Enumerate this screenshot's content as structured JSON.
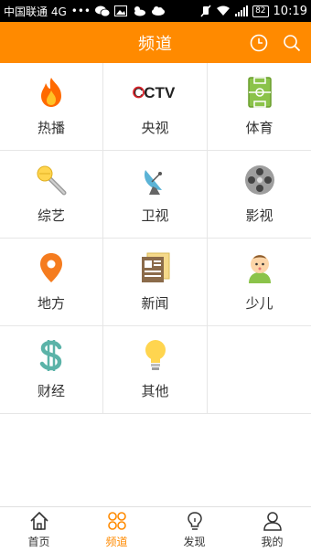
{
  "status_bar": {
    "carrier": "中国联通 4G",
    "dots": "•••",
    "battery": "82",
    "time": "10:19"
  },
  "header": {
    "title": "频道",
    "history_icon": "clock-icon",
    "search_icon": "search-icon"
  },
  "channels": [
    {
      "label": "热播",
      "icon": "fire-icon"
    },
    {
      "label": "央视",
      "icon": "cctv-logo-icon"
    },
    {
      "label": "体育",
      "icon": "soccer-field-icon"
    },
    {
      "label": "综艺",
      "icon": "microphone-icon"
    },
    {
      "label": "卫视",
      "icon": "satellite-dish-icon"
    },
    {
      "label": "影视",
      "icon": "film-reel-icon"
    },
    {
      "label": "地方",
      "icon": "map-pin-icon"
    },
    {
      "label": "新闻",
      "icon": "newspaper-icon"
    },
    {
      "label": "少儿",
      "icon": "baby-icon"
    },
    {
      "label": "财经",
      "icon": "dollar-icon"
    },
    {
      "label": "其他",
      "icon": "lightbulb-icon"
    }
  ],
  "cctv_text": "CCTV",
  "bottom_nav": {
    "items": [
      {
        "label": "首页",
        "icon": "home-icon"
      },
      {
        "label": "频道",
        "icon": "channels-grid-icon",
        "active": true
      },
      {
        "label": "发现",
        "icon": "discover-bulb-icon"
      },
      {
        "label": "我的",
        "icon": "user-icon"
      }
    ]
  },
  "colors": {
    "accent": "#ff8a00",
    "fire": "#ff6a00",
    "green": "#8bc34a",
    "teal": "#5bb3a8"
  }
}
